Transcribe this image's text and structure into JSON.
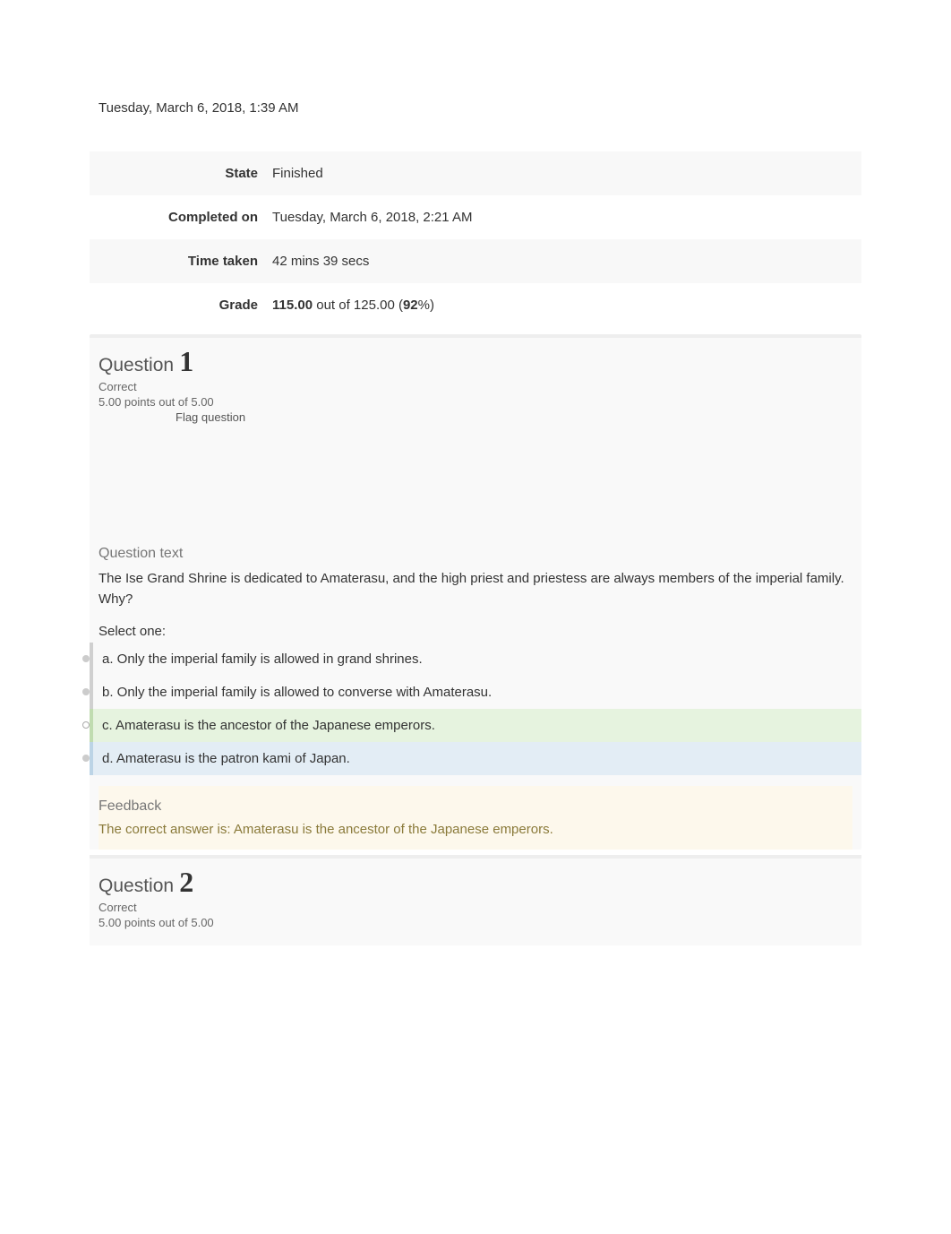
{
  "started": "Tuesday, March 6, 2018, 1:39 AM",
  "summary": {
    "state_label": "State",
    "state_value": "Finished",
    "completed_label": "Completed on",
    "completed_value": "Tuesday, March 6, 2018, 2:21 AM",
    "time_label": "Time taken",
    "time_value": "42 mins 39 secs",
    "grade_label": "Grade",
    "grade_score": "115.00",
    "grade_mid": " out of 125.00 (",
    "grade_pct": "92",
    "grade_tail": "%)"
  },
  "q1": {
    "word": "Question",
    "number": "1",
    "state": "Correct",
    "grade": "5.00 points out of 5.00",
    "flag": "Flag question",
    "section_title": "Question text",
    "text": "The Ise Grand Shrine is dedicated to Amaterasu, and the high priest and priestess are always members of the imperial family. Why?",
    "select": "Select one:",
    "opts": {
      "a": "a. Only the imperial family is allowed in grand shrines.",
      "b": "b. Only the imperial family is allowed to converse with Amaterasu.",
      "c": "c. Amaterasu is the ancestor of the Japanese emperors.",
      "d": "d. Amaterasu is the patron kami of Japan."
    },
    "feedback_title": "Feedback",
    "feedback_text": "The correct answer is: Amaterasu is the ancestor of the Japanese emperors."
  },
  "q2": {
    "word": "Question",
    "number": "2",
    "state": "Correct",
    "grade": "5.00 points out of 5.00"
  }
}
